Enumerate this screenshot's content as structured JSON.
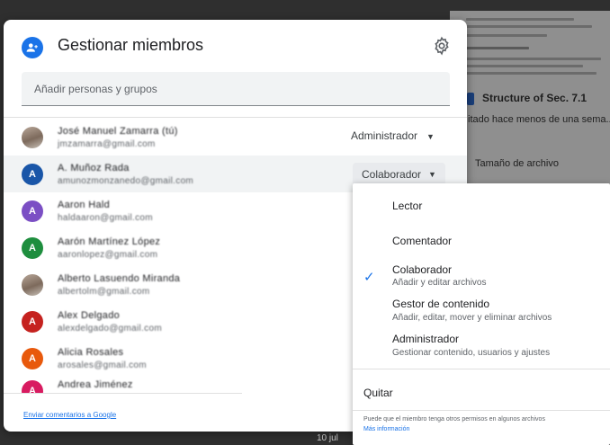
{
  "background": {
    "doc_title": "Structure of Sec. 7.1",
    "doc_subtitle": "itado hace menos de una sema...",
    "size_label": "Tamaño de archivo",
    "bottom_text": "10 jul"
  },
  "dialog": {
    "title": "Gestionar miembros",
    "add_placeholder": "Añadir personas y grupos",
    "feedback_link": "Enviar comentarios a Google"
  },
  "members": [
    {
      "name": "José Manuel Zamarra (tú)",
      "email": "jmzamarra@gmail.com",
      "role": "Administrador",
      "avatar": "photo"
    },
    {
      "name": "A. Muñoz Rada",
      "email": "amunozmonzanedo@gmail.com",
      "role": "Colaborador",
      "avatar": "A",
      "color": "#1a56a8"
    },
    {
      "name": "Aaron Hald",
      "email": "haldaaron@gmail.com",
      "role": "",
      "avatar": "A",
      "color": "#7b4fc4"
    },
    {
      "name": "Aarón Martínez López",
      "email": "aaronlopez@gmail.com",
      "role": "",
      "avatar": "A",
      "color": "#1e8e3e"
    },
    {
      "name": "Alberto Lasuendo Miranda",
      "email": "albertolm@gmail.com",
      "role": "",
      "avatar": "photo"
    },
    {
      "name": "Alex Delgado",
      "email": "alexdelgado@gmail.com",
      "role": "",
      "avatar": "A",
      "color": "#c5221f"
    },
    {
      "name": "Alicia Rosales",
      "email": "arosales@gmail.com",
      "role": "",
      "avatar": "A",
      "color": "#e8590c"
    },
    {
      "name": "Andrea Jiménez",
      "email": "",
      "role": "",
      "avatar": "A",
      "color": "#d81b60"
    }
  ],
  "menu": {
    "options": [
      {
        "label": "Lector",
        "sub": ""
      },
      {
        "label": "Comentador",
        "sub": ""
      },
      {
        "label": "Colaborador",
        "sub": "Añadir y editar archivos",
        "checked": true
      },
      {
        "label": "Gestor de contenido",
        "sub": "Añadir, editar, mover y eliminar archivos"
      },
      {
        "label": "Administrador",
        "sub": "Gestionar contenido, usuarios y ajustes"
      }
    ],
    "remove_label": "Quitar",
    "note": "Puede que el miembro tenga otros permisos en algunos archivos",
    "more_info": "Más información"
  },
  "icons": {
    "add_person": "add-person-icon",
    "settings": "gear-icon",
    "check": "check-icon",
    "caret": "caret-down-icon"
  },
  "colors": {
    "accent": "#1a73e8"
  }
}
